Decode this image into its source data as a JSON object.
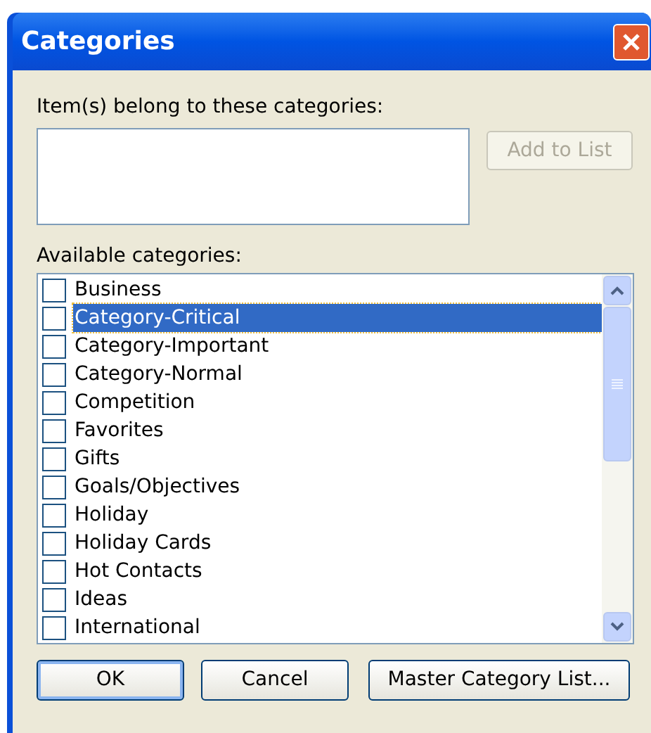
{
  "window": {
    "title": "Categories"
  },
  "items_label": "Item(s) belong to these categories:",
  "add_button": {
    "label": "Add to List",
    "disabled": true
  },
  "available_label": "Available categories:",
  "categories": [
    {
      "label": "Business",
      "checked": false,
      "selected": false
    },
    {
      "label": "Category-Critical",
      "checked": false,
      "selected": true
    },
    {
      "label": "Category-Important",
      "checked": false,
      "selected": false
    },
    {
      "label": "Category-Normal",
      "checked": false,
      "selected": false
    },
    {
      "label": "Competition",
      "checked": false,
      "selected": false
    },
    {
      "label": "Favorites",
      "checked": false,
      "selected": false
    },
    {
      "label": "Gifts",
      "checked": false,
      "selected": false
    },
    {
      "label": "Goals/Objectives",
      "checked": false,
      "selected": false
    },
    {
      "label": "Holiday",
      "checked": false,
      "selected": false
    },
    {
      "label": "Holiday Cards",
      "checked": false,
      "selected": false
    },
    {
      "label": "Hot Contacts",
      "checked": false,
      "selected": false
    },
    {
      "label": "Ideas",
      "checked": false,
      "selected": false
    },
    {
      "label": "International",
      "checked": false,
      "selected": false
    }
  ],
  "buttons": [
    {
      "label": "OK",
      "default": true
    },
    {
      "label": "Cancel",
      "default": false
    },
    {
      "label": "Master Category List...",
      "default": false
    }
  ]
}
